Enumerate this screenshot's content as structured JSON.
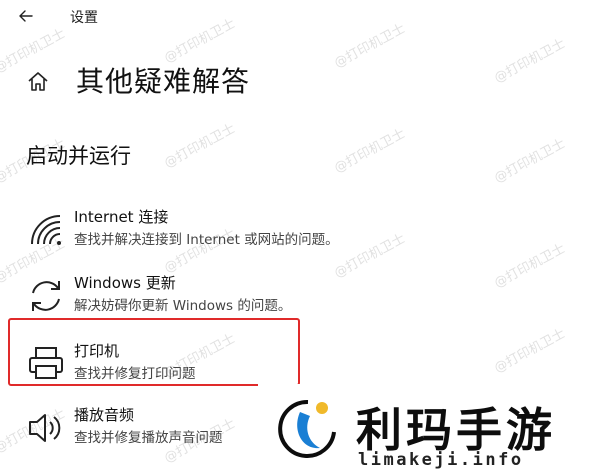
{
  "window": {
    "title": "设置"
  },
  "page": {
    "title": "其他疑难解答"
  },
  "section": {
    "title": "启动并运行"
  },
  "items": [
    {
      "title": "Internet 连接",
      "desc": "查找并解决连接到 Internet 或网站的问题。",
      "icon": "wifi-icon"
    },
    {
      "title": "Windows 更新",
      "desc": "解决妨碍你更新 Windows 的问题。",
      "icon": "sync-icon"
    },
    {
      "title": "打印机",
      "desc": "查找并修复打印问题",
      "icon": "printer-icon"
    },
    {
      "title": "播放音频",
      "desc": "查找并修复播放声音问题",
      "icon": "speaker-icon"
    }
  ],
  "watermark": {
    "text": "@打印机卫士"
  },
  "logo": {
    "brand": "利玛手游",
    "domain": "limakeji.info"
  },
  "colors": {
    "highlight": "#e02a2a",
    "logo_blue": "#1a7fd4"
  }
}
